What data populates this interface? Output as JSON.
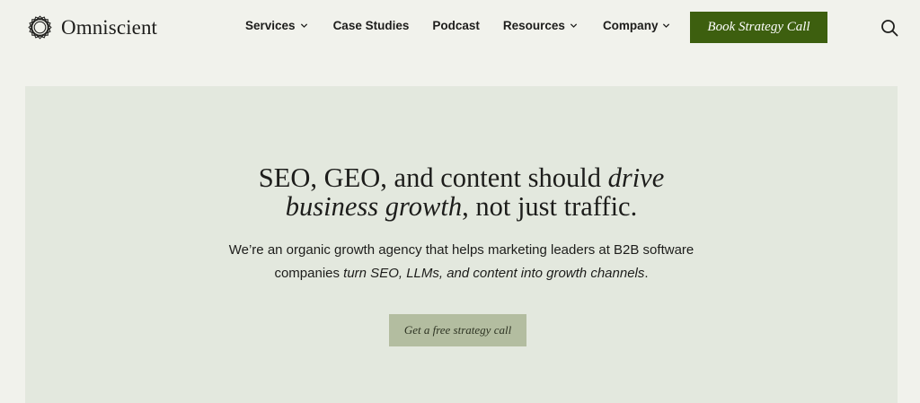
{
  "brand": {
    "name": "Omniscient",
    "logo_icon": "omniscient-knot-icon"
  },
  "nav": {
    "items": [
      {
        "label": "Services",
        "has_dropdown": true
      },
      {
        "label": "Case Studies",
        "has_dropdown": false
      },
      {
        "label": "Podcast",
        "has_dropdown": false
      },
      {
        "label": "Resources",
        "has_dropdown": true
      },
      {
        "label": "Company",
        "has_dropdown": true
      }
    ],
    "cta_label": "Book Strategy Call",
    "search_icon": "search-icon"
  },
  "hero": {
    "headline_part1": "SEO, GEO, and content should ",
    "headline_em1": "drive",
    "headline_em2": "business growth",
    "headline_part2": ", not just traffic.",
    "sub_part1": "We’re an organic growth agency that helps marketing leaders at B2B software",
    "sub_part2": "companies ",
    "sub_em": "turn SEO, LLMs, and content into growth channels",
    "sub_end": ".",
    "button_label": "Get a free strategy call"
  },
  "colors": {
    "page_bg": "#f1f2ec",
    "hero_bg": "#e3e8de",
    "cta_bg": "#3d5f0f",
    "hero_button_bg": "#b3bda0"
  }
}
